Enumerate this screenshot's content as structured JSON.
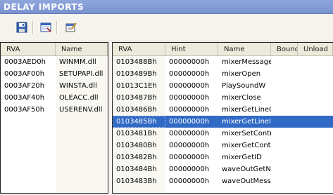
{
  "window": {
    "title": "DELAY IMPORTS"
  },
  "toolbar": {
    "buttons": [
      {
        "icon": "save-icon"
      },
      {
        "icon": "view-icon"
      },
      {
        "icon": "properties-icon"
      }
    ]
  },
  "left": {
    "columns": [
      "RVA",
      "Name"
    ],
    "rows": [
      {
        "rva": "0003AED0h",
        "name": "WINMM.dll"
      },
      {
        "rva": "0003AF00h",
        "name": "SETUPAPI.dll"
      },
      {
        "rva": "0003AF20h",
        "name": "WINSTA.dll"
      },
      {
        "rva": "0003AF40h",
        "name": "OLEACC.dll"
      },
      {
        "rva": "0003AF50h",
        "name": "USERENV.dll"
      }
    ]
  },
  "right": {
    "columns": [
      "RVA",
      "Hint",
      "Name",
      "Bound",
      "Unload"
    ],
    "selected_index": 5,
    "rows": [
      {
        "rva": "0103488Bh",
        "hint": "00000000h",
        "name": "mixerMessage"
      },
      {
        "rva": "0103489Bh",
        "hint": "00000000h",
        "name": "mixerOpen"
      },
      {
        "rva": "01013C1Eh",
        "hint": "00000000h",
        "name": "PlaySoundW"
      },
      {
        "rva": "0103487Bh",
        "hint": "00000000h",
        "name": "mixerClose"
      },
      {
        "rva": "0103486Bh",
        "hint": "00000000h",
        "name": "mixerGetLineC"
      },
      {
        "rva": "0103485Bh",
        "hint": "00000000h",
        "name": "mixerGetLineI"
      },
      {
        "rva": "0103481Bh",
        "hint": "00000000h",
        "name": "mixerSetContr"
      },
      {
        "rva": "0103480Bh",
        "hint": "00000000h",
        "name": "mixerGetCont"
      },
      {
        "rva": "0103482Bh",
        "hint": "00000000h",
        "name": "mixerGetID"
      },
      {
        "rva": "0103484Bh",
        "hint": "00000000h",
        "name": "waveOutGetN"
      },
      {
        "rva": "0103483Bh",
        "hint": "00000000h",
        "name": "waveOutMess"
      }
    ]
  }
}
